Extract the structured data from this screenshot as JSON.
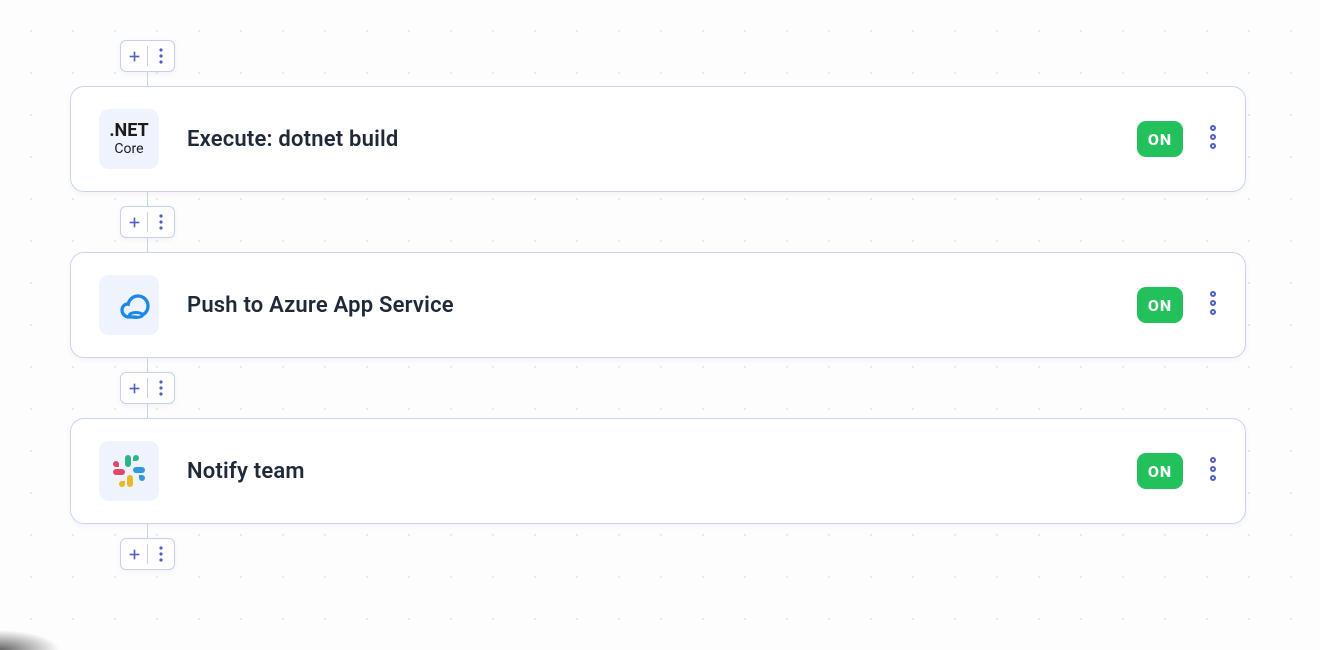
{
  "steps": [
    {
      "icon": "dotnet-core",
      "label": "Execute: dotnet build",
      "status": "ON"
    },
    {
      "icon": "azure-cloud",
      "label": "Push to Azure App Service",
      "status": "ON"
    },
    {
      "icon": "slack",
      "label": "Notify team",
      "status": "ON"
    }
  ],
  "dotnet": {
    "top": ".NET",
    "bot": "Core"
  },
  "colors": {
    "on": "#23c15c",
    "indigo": "#4f5fc6",
    "azure": "#1b87e6",
    "slack": {
      "teal": "#2eb487",
      "blue": "#2f9ae0",
      "red": "#e2486a",
      "yellow": "#e9b82b"
    }
  }
}
